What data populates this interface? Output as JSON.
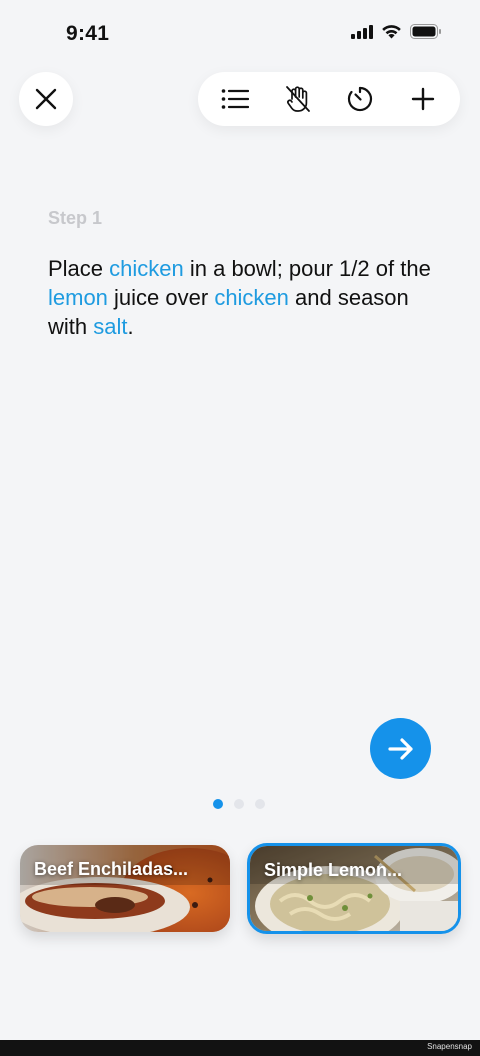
{
  "status_bar": {
    "time": "9:41",
    "icons": [
      "cellular-signal-icon",
      "wifi-icon",
      "battery-icon"
    ]
  },
  "toolbar": {
    "close_icon": "close-icon",
    "buttons": [
      "ingredients-list-icon",
      "hands-free-off-icon",
      "timer-icon",
      "add-icon"
    ]
  },
  "step": {
    "label": "Step 1",
    "segments": [
      {
        "text": "Place ",
        "highlight": false
      },
      {
        "text": "chicken",
        "highlight": true
      },
      {
        "text": " in a bowl; pour 1/2 of the ",
        "highlight": false
      },
      {
        "text": "lemon",
        "highlight": true
      },
      {
        "text": " juice over ",
        "highlight": false
      },
      {
        "text": "chicken",
        "highlight": true
      },
      {
        "text": " and season with ",
        "highlight": false
      },
      {
        "text": "salt",
        "highlight": true
      },
      {
        "text": ".",
        "highlight": false
      }
    ]
  },
  "pagination": {
    "total": 3,
    "current": 1
  },
  "next_icon": "arrow-right-icon",
  "recipes": [
    {
      "title": "Beef Enchiladas...",
      "selected": false
    },
    {
      "title": "Simple Lemon...",
      "selected": true
    }
  ],
  "colors": {
    "accent": "#1592ea",
    "highlight_text": "#1e9be0",
    "background": "#f4f5f7"
  },
  "watermark": "Snapensnap"
}
